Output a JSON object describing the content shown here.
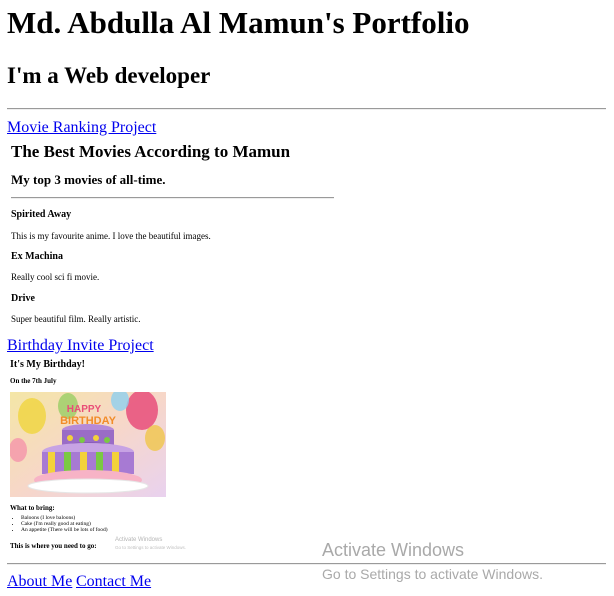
{
  "header": {
    "title": "Md. Abdulla Al Mamun's Portfolio",
    "subtitle": "I'm a Web developer"
  },
  "projects": {
    "movie_link": "Movie Ranking Project",
    "movie_frame": {
      "title": "The Best Movies According to Mamun",
      "subtitle": "My top 3 movies of all-time.",
      "movies": [
        {
          "name": "Spirited Away",
          "desc": "This is my favourite anime. I love the beautiful images."
        },
        {
          "name": "Ex Machina",
          "desc": "Really cool sci fi movie."
        },
        {
          "name": "Drive",
          "desc": "Super beautiful film. Really artistic."
        }
      ]
    },
    "birthday_link": "Birthday Invite Project",
    "birthday_frame": {
      "title": "It's My Birthday!",
      "date": "On the 7th July",
      "image_icon": "birthday-cake-image",
      "bring_heading": "What to bring:",
      "bring_items": [
        "Baloons (I love baloons)",
        "Cake (I'm really good at eating)",
        "An appetite (There will be lots of food)"
      ],
      "where": "This is where you need to go:",
      "inner_watermark_title": "Activate Windows",
      "inner_watermark_sub": "Go to Settings to activate Windows."
    }
  },
  "footer": {
    "about": "About Me",
    "contact": "Contact Me"
  },
  "watermark": {
    "title": "Activate Windows",
    "subtitle": "Go to Settings to activate Windows."
  },
  "colors": {
    "link": "#0000ee",
    "rule": "#9a9a9a",
    "watermark": "#a9a9a9"
  }
}
